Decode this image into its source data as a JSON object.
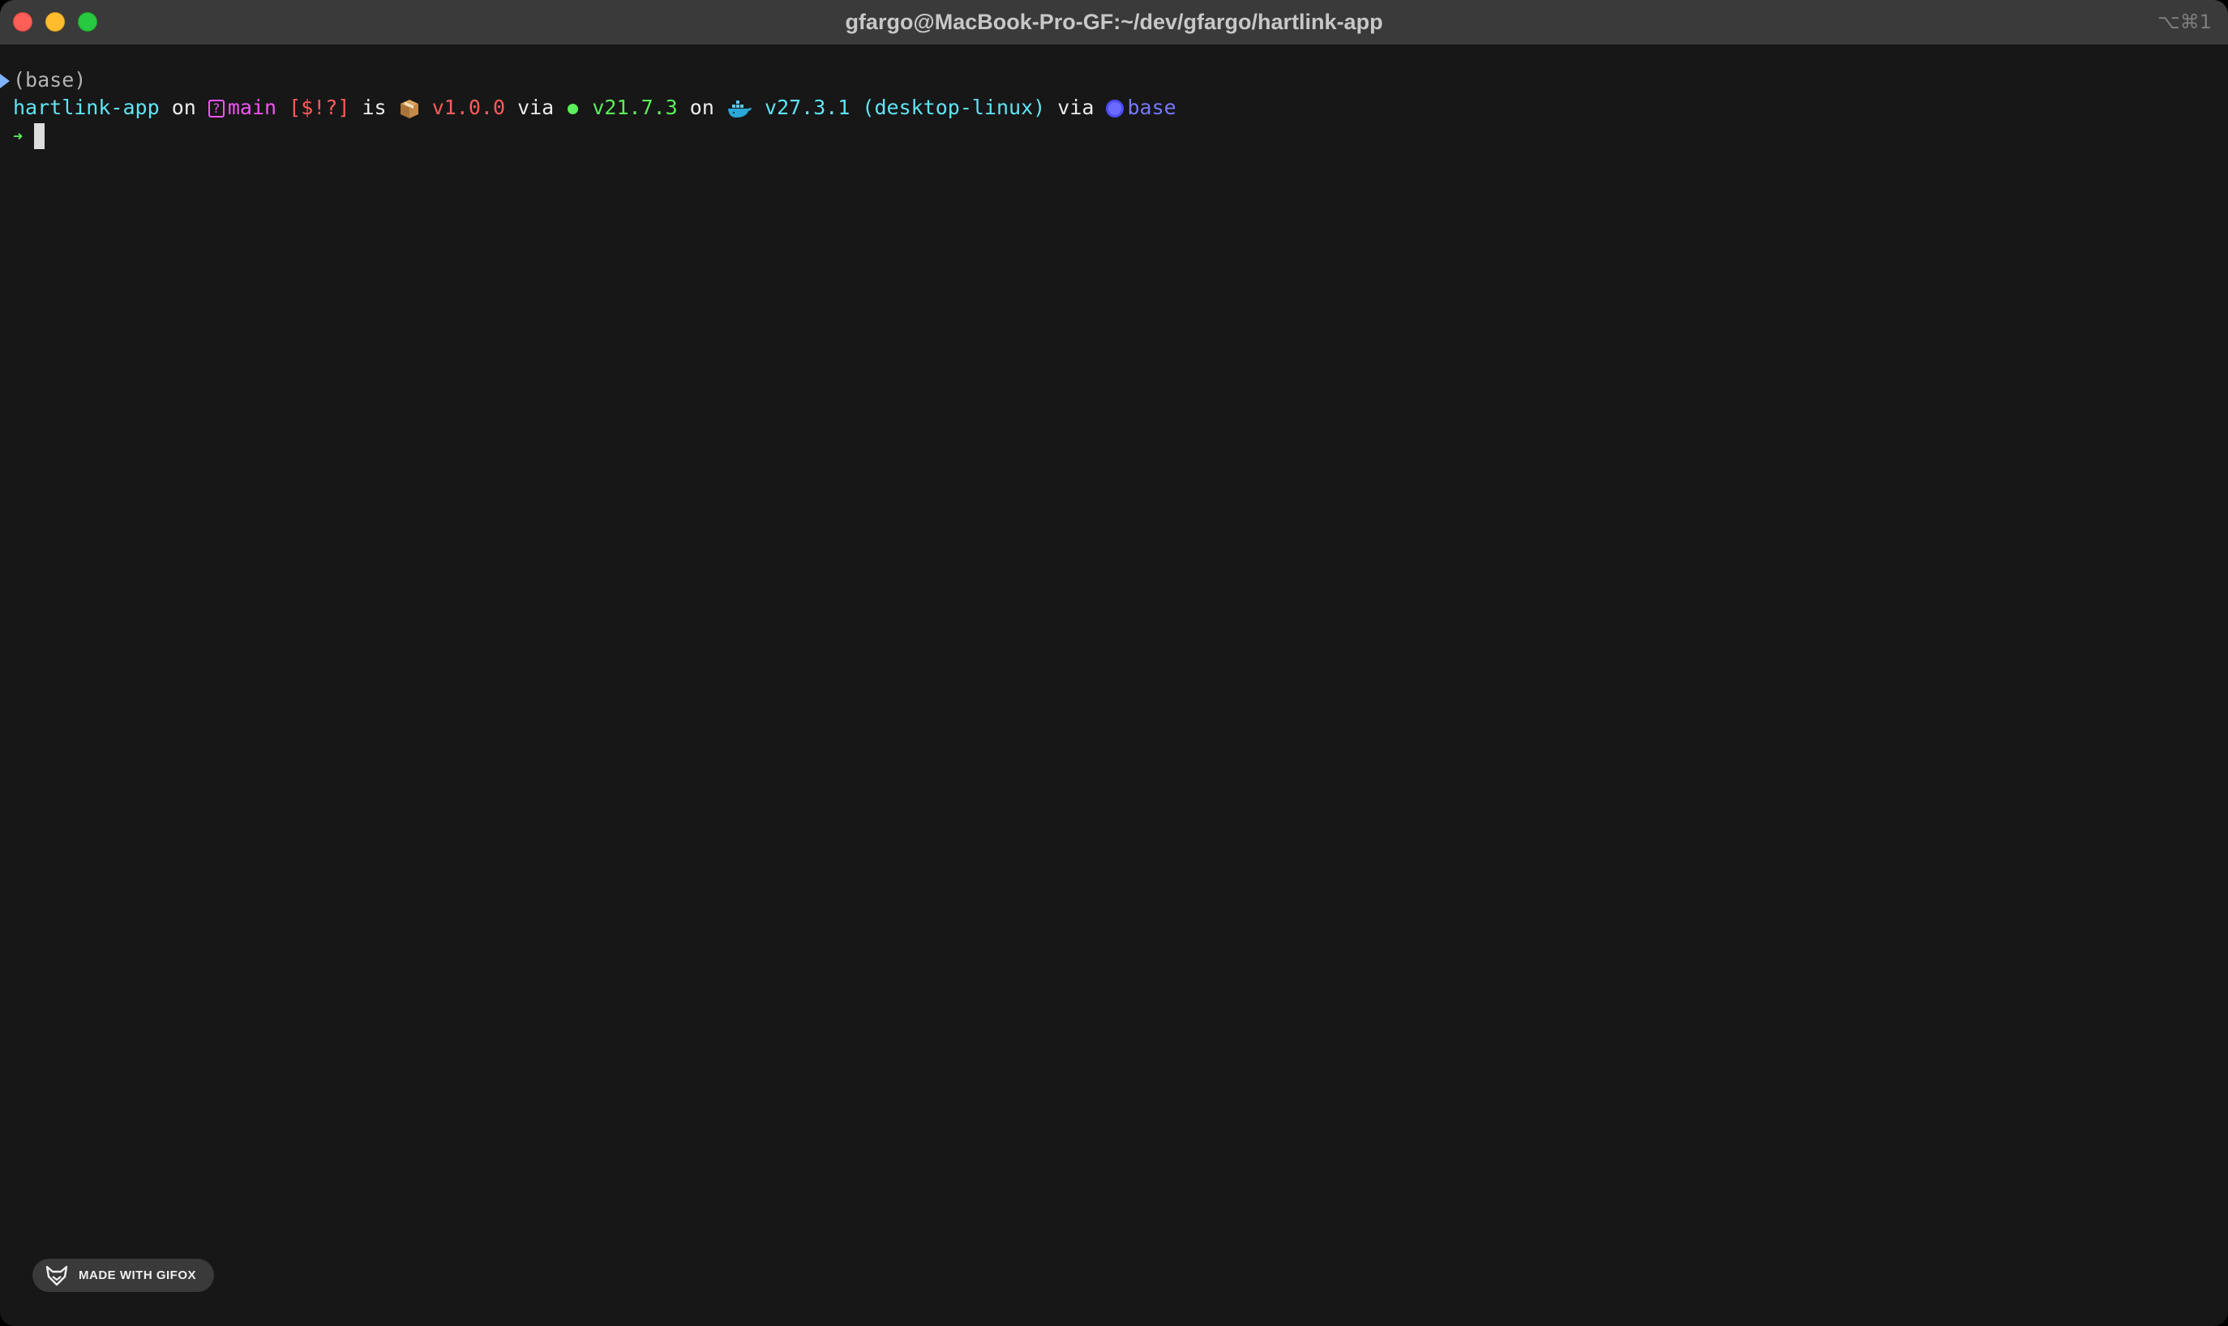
{
  "window": {
    "title": "gfargo@MacBook-Pro-GF:~/dev/gfargo/hartlink-app",
    "shortcut": "⌥⌘1"
  },
  "terminal": {
    "env_line": "(base)",
    "prompt": {
      "directory": "hartlink-app",
      "on_1": "on",
      "branch": "main",
      "git_status": "[$!?]",
      "is": "is",
      "package_version": "v1.0.0",
      "via_1": "via",
      "node_version": "v21.7.3",
      "on_2": "on",
      "docker_context": "v27.3.1 (desktop-linux)",
      "via_2": "via",
      "conda_env": "base"
    },
    "input_arrow": "➜"
  },
  "badge": {
    "label": "MADE WITH GIFOX"
  },
  "colors": {
    "background": "#171717",
    "titlebar": "#3a3a3a",
    "cyan": "#5fe5f5",
    "magenta": "#f254f2",
    "red": "#ff5c5c",
    "green": "#5bf05b",
    "blue": "#7878ff"
  }
}
